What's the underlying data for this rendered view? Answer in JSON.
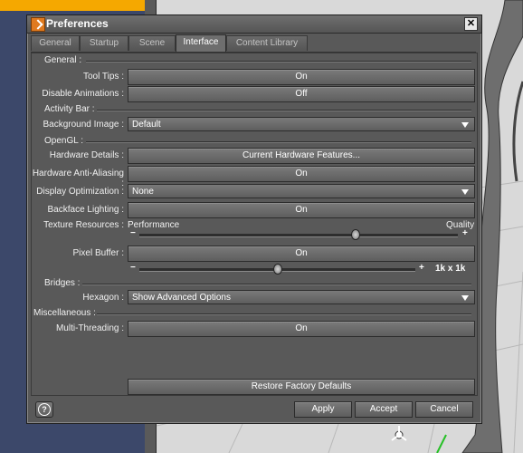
{
  "dialog": {
    "title": "Preferences",
    "close_glyph": "✕"
  },
  "tabs": [
    {
      "label": "General"
    },
    {
      "label": "Startup"
    },
    {
      "label": "Scene"
    },
    {
      "label": "Interface",
      "active": true
    },
    {
      "label": "Content Library"
    }
  ],
  "sections": {
    "general": "General :",
    "activity_bar": "Activity Bar :",
    "opengl": "OpenGL :",
    "bridges": "Bridges :",
    "misc": "Miscellaneous :"
  },
  "settings": {
    "tool_tips": {
      "label": "Tool Tips :",
      "value": "On"
    },
    "disable_animations": {
      "label": "Disable Animations :",
      "value": "Off"
    },
    "background_image": {
      "label": "Background Image :",
      "value": "Default"
    },
    "hardware_details": {
      "label": "Hardware Details :",
      "value": "Current Hardware Features..."
    },
    "hardware_aa": {
      "label": "Hardware Anti-Aliasing :",
      "value": "On"
    },
    "display_optimization": {
      "label": "Display Optimization :",
      "value": "None"
    },
    "backface_lighting": {
      "label": "Backface Lighting :",
      "value": "On"
    },
    "texture_resources": {
      "label": "Texture Resources :",
      "min_label": "Performance",
      "max_label": "Quality",
      "minus": "−",
      "plus": "+",
      "level": 0.68
    },
    "pixel_buffer": {
      "label": "Pixel Buffer :",
      "value": "On",
      "minus": "−",
      "plus": "+",
      "level": 0.5,
      "readout": "1k x 1k"
    },
    "hexagon": {
      "label": "Hexagon :",
      "value": "Show Advanced Options"
    },
    "multi_threading": {
      "label": "Multi-Threading :",
      "value": "On"
    }
  },
  "buttons": {
    "restore": "Restore Factory Defaults",
    "apply": "Apply",
    "accept": "Accept",
    "cancel": "Cancel",
    "help": "?"
  },
  "colors": {
    "accent_orange": "#f5a800",
    "dialog_bg": "#595959"
  }
}
